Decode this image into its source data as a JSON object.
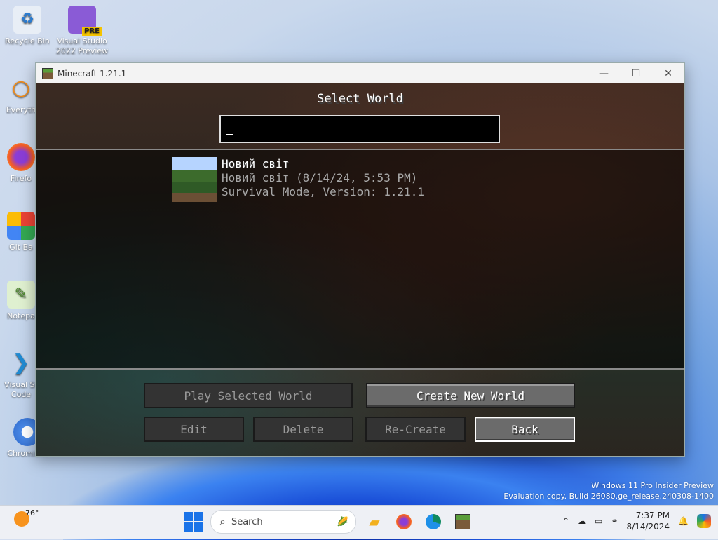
{
  "desktop": {
    "icons": [
      {
        "label": "Recycle Bin"
      },
      {
        "label": "Visual Studio 2022 Preview",
        "badge": "PRE"
      },
      {
        "label": "Everyth"
      },
      {
        "label": "Firefo"
      },
      {
        "label": "Git Ba"
      },
      {
        "label": "Notepa"
      },
      {
        "label": "Visual St Code"
      },
      {
        "label": "Chromium"
      }
    ],
    "watermark_line1": "Windows 11 Pro Insider Preview",
    "watermark_line2": "Evaluation copy. Build 26080.ge_release.240308-1400"
  },
  "window": {
    "title": "Minecraft 1.21.1",
    "minimize": "—",
    "maximize": "☐",
    "close": "✕"
  },
  "screen": {
    "title": "Select World",
    "search_value": "",
    "worlds": [
      {
        "name": "Новий світ",
        "detail": "Новий світ (8/14/24, 5:53 PM)",
        "mode": "Survival Mode, Version: 1.21.1"
      }
    ],
    "buttons": {
      "play": "Play Selected World",
      "create": "Create New World",
      "edit": "Edit",
      "delete": "Delete",
      "recreate": "Re-Create",
      "back": "Back"
    }
  },
  "taskbar": {
    "weather_temp": "76°",
    "search_placeholder": "Search",
    "time": "7:37 PM",
    "date": "8/14/2024"
  },
  "colors": {
    "accent": "#1a73e8",
    "button_face": "#6b6b6b",
    "button_disabled": "#333333"
  }
}
